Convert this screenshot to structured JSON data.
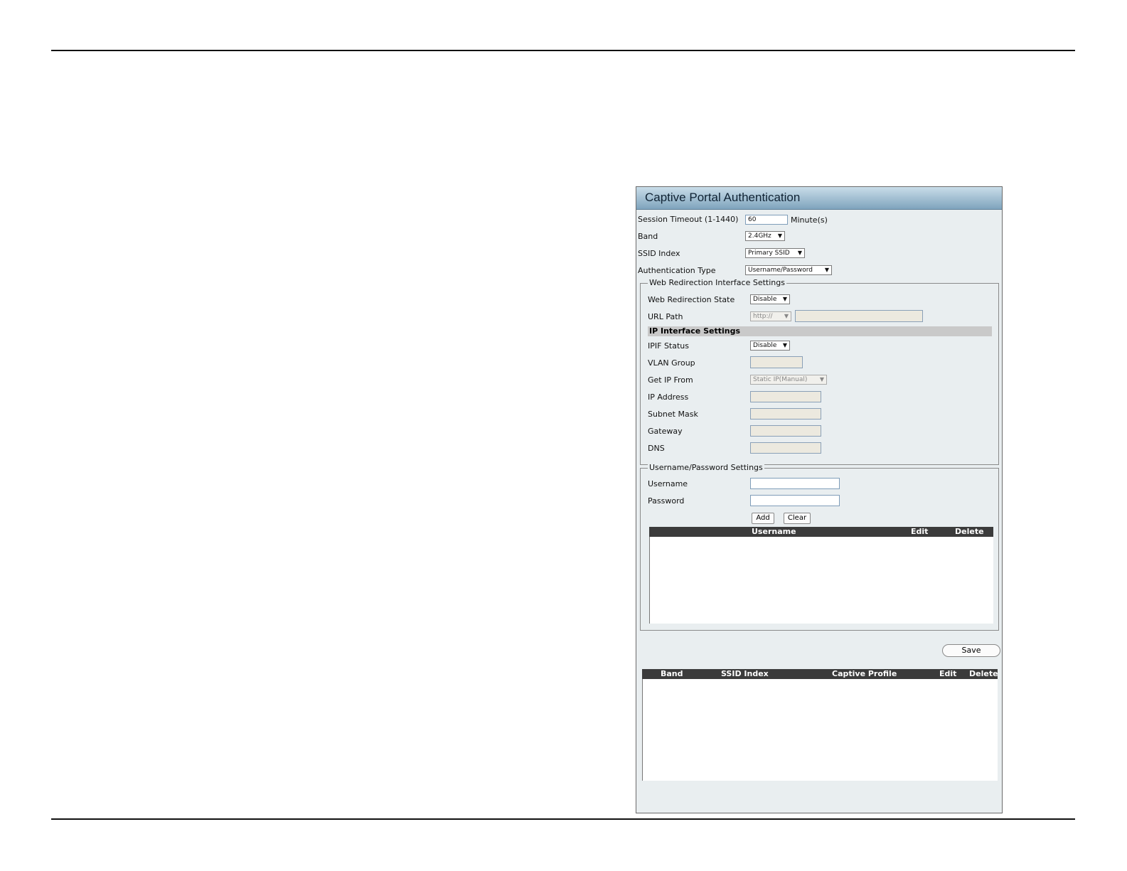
{
  "panel": {
    "title": "Captive Portal Authentication",
    "session_timeout": {
      "label": "Session Timeout (1-1440)",
      "value": "60",
      "unit": "Minute(s)"
    },
    "band": {
      "label": "Band",
      "value": "2.4GHz"
    },
    "ssid_index": {
      "label": "SSID Index",
      "value": "Primary SSID"
    },
    "auth_type": {
      "label": "Authentication Type",
      "value": "Username/Password"
    }
  },
  "web_redirect": {
    "legend": "Web Redirection Interface Settings",
    "state": {
      "label": "Web Redirection State",
      "value": "Disable"
    },
    "url_path": {
      "label": "URL Path",
      "scheme": "http://",
      "value": ""
    },
    "ip_settings": {
      "heading": "IP Interface Settings",
      "ipif_status": {
        "label": "IPIF Status",
        "value": "Disable"
      },
      "vlan_group": {
        "label": "VLAN Group",
        "value": ""
      },
      "get_ip_from": {
        "label": "Get IP From",
        "value": "Static IP(Manual)"
      },
      "ip_address": {
        "label": "IP Address",
        "value": ""
      },
      "subnet_mask": {
        "label": "Subnet Mask",
        "value": ""
      },
      "gateway": {
        "label": "Gateway",
        "value": ""
      },
      "dns": {
        "label": "DNS",
        "value": ""
      }
    }
  },
  "userpass": {
    "legend": "Username/Password Settings",
    "username": {
      "label": "Username",
      "value": ""
    },
    "password": {
      "label": "Password",
      "value": ""
    },
    "add_label": "Add",
    "clear_label": "Clear",
    "table_headers": {
      "username": "Username",
      "edit": "Edit",
      "delete": "Delete"
    }
  },
  "save_label": "Save",
  "profile_table": {
    "headers": {
      "band": "Band",
      "ssid_index": "SSID Index",
      "captive_profile": "Captive Profile",
      "edit": "Edit",
      "delete": "Delete"
    }
  },
  "icons": {
    "dropdown": "caret-down-icon"
  }
}
